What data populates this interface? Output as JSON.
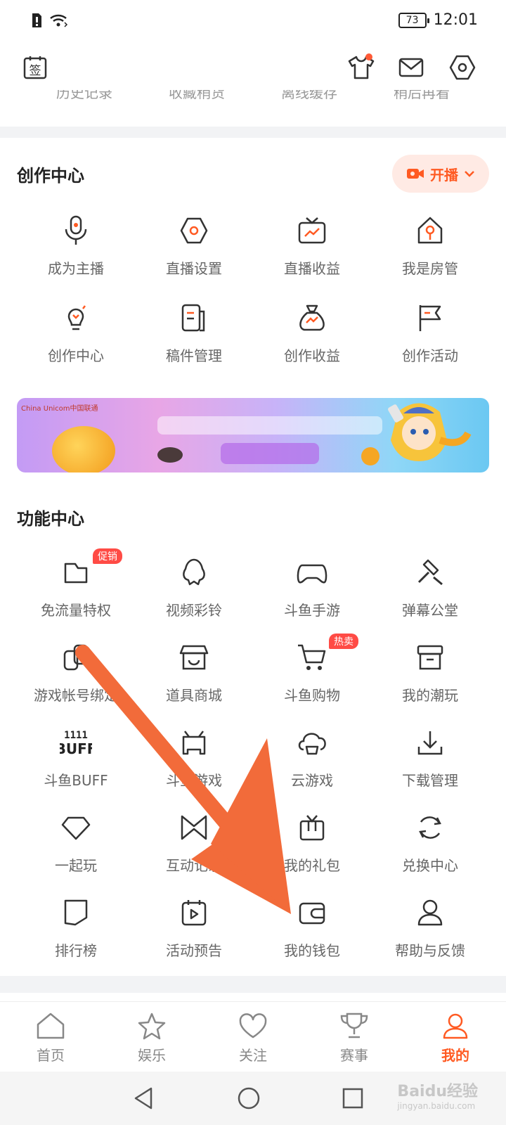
{
  "status": {
    "battery": "73",
    "time": "12:01"
  },
  "topbar": {
    "sign_label": "签"
  },
  "cutoff": [
    "历史记录",
    "收藏稍货",
    "离线缓存",
    "稍后再看"
  ],
  "creation": {
    "title": "创作中心",
    "live_button": "开播",
    "items": [
      {
        "label": "成为主播",
        "icon": "microphone-icon"
      },
      {
        "label": "直播设置",
        "icon": "hexagon-settings-icon"
      },
      {
        "label": "直播收益",
        "icon": "tv-chart-icon"
      },
      {
        "label": "我是房管",
        "icon": "house-key-icon"
      },
      {
        "label": "创作中心",
        "icon": "lightbulb-icon"
      },
      {
        "label": "稿件管理",
        "icon": "document-icon"
      },
      {
        "label": "创作收益",
        "icon": "money-bag-icon"
      },
      {
        "label": "创作活动",
        "icon": "flag-icon"
      }
    ]
  },
  "banner": {
    "logo": "China Unicom中国联通"
  },
  "functions": {
    "title": "功能中心",
    "items": [
      {
        "label": "免流量特权",
        "icon": "sim-card-icon",
        "badge": "促销"
      },
      {
        "label": "视频彩铃",
        "icon": "bell-icon"
      },
      {
        "label": "斗鱼手游",
        "icon": "gamepad-icon"
      },
      {
        "label": "弹幕公堂",
        "icon": "gavel-icon"
      },
      {
        "label": "游戏帐号绑定",
        "icon": "link-icon"
      },
      {
        "label": "道具商城",
        "icon": "shop-icon"
      },
      {
        "label": "斗鱼购物",
        "icon": "cart-icon",
        "badge": "热卖"
      },
      {
        "label": "我的潮玩",
        "icon": "box-icon"
      },
      {
        "label": "斗鱼BUFF",
        "icon": "buff-icon",
        "icon_text": "BUFF"
      },
      {
        "label": "斗鱼游戏",
        "icon": "console-icon"
      },
      {
        "label": "云游戏",
        "icon": "cloud-game-icon"
      },
      {
        "label": "下载管理",
        "icon": "download-icon"
      },
      {
        "label": "一起玩",
        "icon": "diamond-icon"
      },
      {
        "label": "互动记录",
        "icon": "bowtie-icon"
      },
      {
        "label": "我的礼包",
        "icon": "gift-icon"
      },
      {
        "label": "兑换中心",
        "icon": "exchange-icon"
      },
      {
        "label": "排行榜",
        "icon": "ranking-icon"
      },
      {
        "label": "活动预告",
        "icon": "calendar-play-icon"
      },
      {
        "label": "我的钱包",
        "icon": "wallet-icon"
      },
      {
        "label": "帮助与反馈",
        "icon": "user-help-icon"
      }
    ]
  },
  "tabs": [
    {
      "label": "首页",
      "icon": "home-icon"
    },
    {
      "label": "娱乐",
      "icon": "star-icon"
    },
    {
      "label": "关注",
      "icon": "heart-icon"
    },
    {
      "label": "赛事",
      "icon": "trophy-icon"
    },
    {
      "label": "我的",
      "icon": "profile-icon",
      "active": true
    }
  ],
  "watermark": {
    "brand": "Baidu经验",
    "url": "jingyan.baidu.com"
  },
  "colors": {
    "accent": "#ff5a22",
    "arrow": "#f26b3a",
    "separator": "#f2f3f5"
  }
}
